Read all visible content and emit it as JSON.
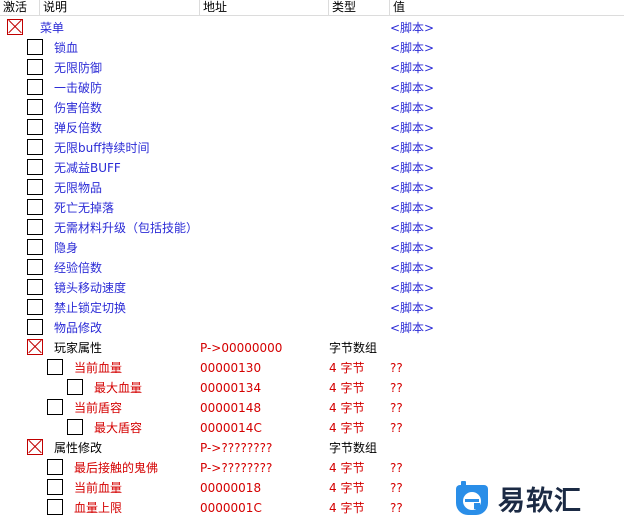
{
  "header": {
    "col_active": "激活",
    "col_desc": "说明",
    "col_addr": "地址",
    "col_type": "类型",
    "col_value": "值"
  },
  "rows": [
    {
      "desc": "菜单",
      "addr": "",
      "type": "",
      "value": "<脚本>"
    },
    {
      "desc": "锁血",
      "addr": "",
      "type": "",
      "value": "<脚本>"
    },
    {
      "desc": "无限防御",
      "addr": "",
      "type": "",
      "value": "<脚本>"
    },
    {
      "desc": "一击破防",
      "addr": "",
      "type": "",
      "value": "<脚本>"
    },
    {
      "desc": "伤害倍数",
      "addr": "",
      "type": "",
      "value": "<脚本>"
    },
    {
      "desc": "弹反倍数",
      "addr": "",
      "type": "",
      "value": "<脚本>"
    },
    {
      "desc": "无限buff持续时间",
      "addr": "",
      "type": "",
      "value": "<脚本>"
    },
    {
      "desc": "无减益BUFF",
      "addr": "",
      "type": "",
      "value": "<脚本>"
    },
    {
      "desc": "无限物品",
      "addr": "",
      "type": "",
      "value": "<脚本>"
    },
    {
      "desc": "死亡无掉落",
      "addr": "",
      "type": "",
      "value": "<脚本>"
    },
    {
      "desc": "无需材料升级（包括技能）",
      "addr": "",
      "type": "",
      "value": "<脚本>"
    },
    {
      "desc": "隐身",
      "addr": "",
      "type": "",
      "value": "<脚本>"
    },
    {
      "desc": "经验倍数",
      "addr": "",
      "type": "",
      "value": "<脚本>"
    },
    {
      "desc": "镜头移动速度",
      "addr": "",
      "type": "",
      "value": "<脚本>"
    },
    {
      "desc": "禁止锁定切换",
      "addr": "",
      "type": "",
      "value": "<脚本>"
    },
    {
      "desc": "物品修改",
      "addr": "",
      "type": "",
      "value": "<脚本>"
    },
    {
      "desc": "玩家属性",
      "addr": "P->00000000",
      "type": "字节数组",
      "value": ""
    },
    {
      "desc": "当前血量",
      "addr": "00000130",
      "type": "4 字节",
      "value": "??"
    },
    {
      "desc": "最大血量",
      "addr": "00000134",
      "type": "4 字节",
      "value": "??"
    },
    {
      "desc": "当前盾容",
      "addr": "00000148",
      "type": "4 字节",
      "value": "??"
    },
    {
      "desc": "最大盾容",
      "addr": "0000014C",
      "type": "4 字节",
      "value": "??"
    },
    {
      "desc": "属性修改",
      "addr": "P->????????",
      "type": "字节数组",
      "value": ""
    },
    {
      "desc": "最后接触的鬼佛",
      "addr": "P->????????",
      "type": "4 字节",
      "value": "??"
    },
    {
      "desc": "当前血量",
      "addr": "00000018",
      "type": "4 字节",
      "value": "??"
    },
    {
      "desc": "血量上限",
      "addr": "0000001C",
      "type": "4 字节",
      "value": "??"
    }
  ],
  "watermark": {
    "text": "易软汇",
    "logo_icon": "logo-icon"
  },
  "colors": {
    "blue": "#2b2bd6",
    "red": "#d40000",
    "checked_x": "#c00000"
  }
}
